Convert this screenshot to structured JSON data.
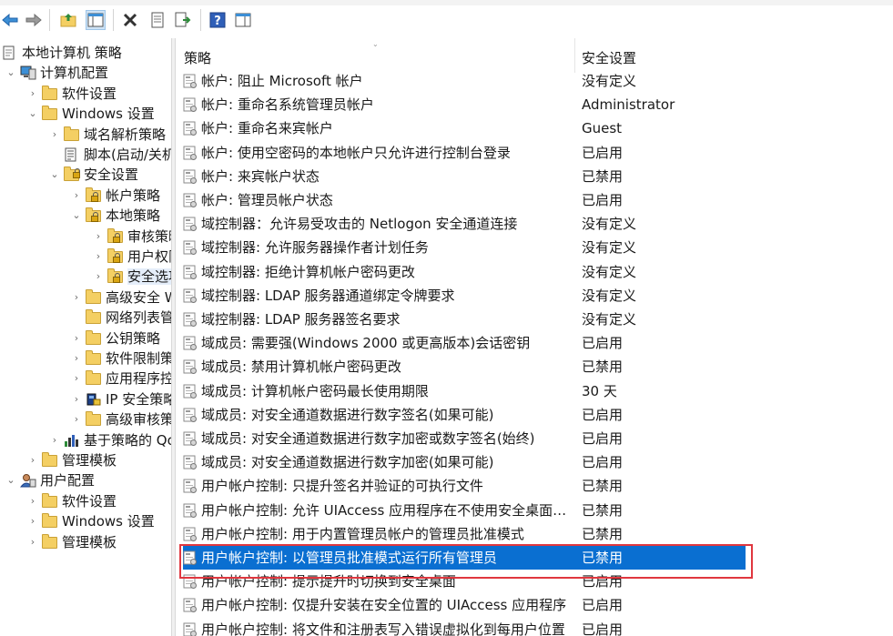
{
  "tree": [
    {
      "label": "本地计算机 策略",
      "level": 0,
      "icon": "policy-doc-icon",
      "chev": "none"
    },
    {
      "label": "计算机配置",
      "level": 1,
      "icon": "computer-icon",
      "chev": "down"
    },
    {
      "label": "软件设置",
      "level": 2,
      "icon": "folder-icon",
      "chev": "right"
    },
    {
      "label": "Windows 设置",
      "level": 2,
      "icon": "folder-icon",
      "chev": "down"
    },
    {
      "label": "域名解析策略",
      "level": 3,
      "icon": "folder-icon",
      "chev": "right"
    },
    {
      "label": "脚本(启动/关机)",
      "level": 3,
      "icon": "script-icon",
      "chev": "none"
    },
    {
      "label": "安全设置",
      "level": 3,
      "icon": "security-icon",
      "chev": "down"
    },
    {
      "label": "帐户策略",
      "level": 4,
      "icon": "lock-folder-icon",
      "chev": "right"
    },
    {
      "label": "本地策略",
      "level": 4,
      "icon": "lock-folder-icon",
      "chev": "down"
    },
    {
      "label": "审核策略",
      "level": 5,
      "icon": "lock-folder-icon",
      "chev": "right"
    },
    {
      "label": "用户权限分配",
      "level": 5,
      "icon": "lock-folder-icon",
      "chev": "right"
    },
    {
      "label": "安全选项",
      "level": 5,
      "icon": "lock-folder-icon",
      "chev": "right",
      "selected": true
    },
    {
      "label": "高级安全 Windows Defender 防火墙",
      "level": 4,
      "icon": "folder-icon",
      "chev": "right"
    },
    {
      "label": "网络列表管理器策略",
      "level": 4,
      "icon": "folder-icon",
      "chev": "none"
    },
    {
      "label": "公钥策略",
      "level": 4,
      "icon": "folder-icon",
      "chev": "right"
    },
    {
      "label": "软件限制策略",
      "level": 4,
      "icon": "folder-icon",
      "chev": "right"
    },
    {
      "label": "应用程序控制策略",
      "level": 4,
      "icon": "folder-icon",
      "chev": "right"
    },
    {
      "label": "IP 安全策略，在 本地计算机",
      "level": 4,
      "icon": "ip-security-icon",
      "chev": "right"
    },
    {
      "label": "高级审核策略配置",
      "level": 4,
      "icon": "folder-icon",
      "chev": "right"
    },
    {
      "label": "基于策略的 QoS",
      "level": 3,
      "icon": "qos-chart-icon",
      "chev": "right"
    },
    {
      "label": "管理模板",
      "level": 2,
      "icon": "folder-icon",
      "chev": "right"
    },
    {
      "label": "用户配置",
      "level": 1,
      "icon": "user-icon",
      "chev": "down"
    },
    {
      "label": "软件设置",
      "level": 2,
      "icon": "folder-icon",
      "chev": "right"
    },
    {
      "label": "Windows 设置",
      "level": 2,
      "icon": "folder-icon",
      "chev": "right"
    },
    {
      "label": "管理模板",
      "level": 2,
      "icon": "folder-icon",
      "chev": "right"
    }
  ],
  "list": {
    "headers": {
      "policy": "策略",
      "setting": "安全设置"
    },
    "rows": [
      {
        "name": "帐户: 阻止 Microsoft 帐户",
        "value": "没有定义"
      },
      {
        "name": "帐户: 重命名系统管理员帐户",
        "value": "Administrator"
      },
      {
        "name": "帐户: 重命名来宾帐户",
        "value": "Guest"
      },
      {
        "name": "帐户: 使用空密码的本地帐户只允许进行控制台登录",
        "value": "已启用"
      },
      {
        "name": "帐户: 来宾帐户状态",
        "value": "已禁用"
      },
      {
        "name": "帐户: 管理员帐户状态",
        "value": "已启用"
      },
      {
        "name": "域控制器：允许易受攻击的 Netlogon 安全通道连接",
        "value": "没有定义"
      },
      {
        "name": "域控制器: 允许服务器操作者计划任务",
        "value": "没有定义"
      },
      {
        "name": "域控制器: 拒绝计算机帐户密码更改",
        "value": "没有定义"
      },
      {
        "name": "域控制器: LDAP 服务器通道绑定令牌要求",
        "value": "没有定义"
      },
      {
        "name": "域控制器: LDAP 服务器签名要求",
        "value": "没有定义"
      },
      {
        "name": "域成员: 需要强(Windows 2000 或更高版本)会话密钥",
        "value": "已启用"
      },
      {
        "name": "域成员: 禁用计算机帐户密码更改",
        "value": "已禁用"
      },
      {
        "name": "域成员: 计算机帐户密码最长使用期限",
        "value": "30 天"
      },
      {
        "name": "域成员: 对安全通道数据进行数字签名(如果可能)",
        "value": "已启用"
      },
      {
        "name": "域成员: 对安全通道数据进行数字加密或数字签名(始终)",
        "value": "已启用"
      },
      {
        "name": "域成员: 对安全通道数据进行数字加密(如果可能)",
        "value": "已启用"
      },
      {
        "name": "用户帐户控制: 只提升签名并验证的可执行文件",
        "value": "已禁用"
      },
      {
        "name": "用户帐户控制: 允许 UIAccess 应用程序在不使用安全桌面的情况下提升权限",
        "value": "已禁用"
      },
      {
        "name": "用户帐户控制: 用于内置管理员帐户的管理员批准模式",
        "value": "已禁用"
      },
      {
        "name": "用户帐户控制: 以管理员批准模式运行所有管理员",
        "value": "已禁用",
        "selected": true
      },
      {
        "name": "用户帐户控制: 提示提升时切换到安全桌面",
        "value": "已启用"
      },
      {
        "name": "用户帐户控制: 仅提升安装在安全位置的 UIAccess 应用程序",
        "value": "已启用"
      },
      {
        "name": "用户帐户控制: 将文件和注册表写入错误虚拟化到每用户位置",
        "value": "已启用"
      }
    ]
  },
  "colors": {
    "selection": "#0a6fd1",
    "highlight_box": "#e0373f"
  }
}
